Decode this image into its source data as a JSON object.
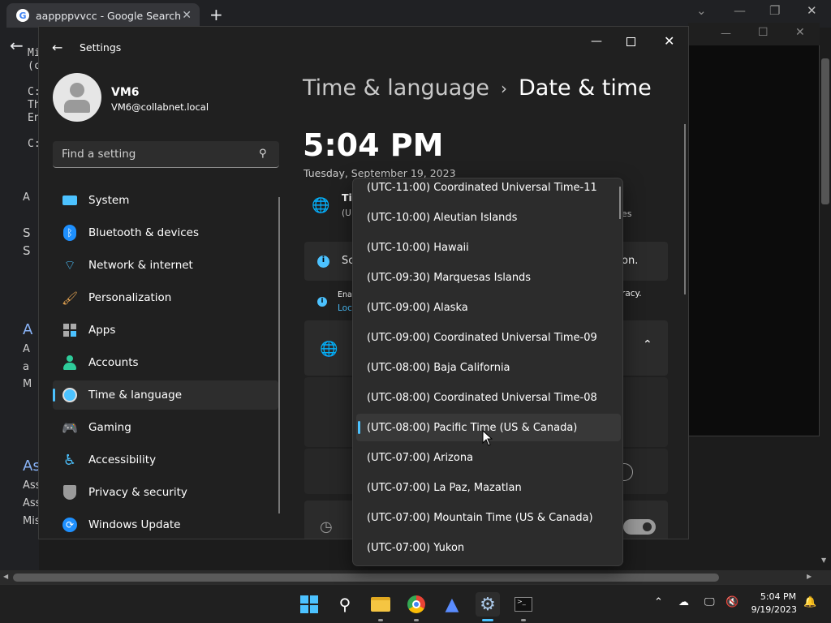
{
  "chrome": {
    "tab_title": "aappppvvcc - Google Search",
    "left_fragments": [
      "Mi",
      "(c",
      "C:",
      "Th",
      "En",
      "C:",
      "A",
      "S",
      "S",
      "A",
      "A",
      "a",
      "M",
      "As",
      "Ass",
      "Ass",
      "Mis"
    ]
  },
  "settings": {
    "window_title": "Settings",
    "user": {
      "name": "VM6",
      "email": "VM6@collabnet.local"
    },
    "search_placeholder": "Find a setting",
    "nav": [
      {
        "label": "System",
        "icon": "system-icon"
      },
      {
        "label": "Bluetooth & devices",
        "icon": "bluetooth-icon"
      },
      {
        "label": "Network & internet",
        "icon": "wifi-icon"
      },
      {
        "label": "Personalization",
        "icon": "brush-icon"
      },
      {
        "label": "Apps",
        "icon": "apps-icon"
      },
      {
        "label": "Accounts",
        "icon": "account-icon"
      },
      {
        "label": "Time & language",
        "icon": "time-language-icon",
        "active": true
      },
      {
        "label": "Gaming",
        "icon": "gamepad-icon"
      },
      {
        "label": "Accessibility",
        "icon": "accessibility-icon"
      },
      {
        "label": "Privacy & security",
        "icon": "shield-icon"
      },
      {
        "label": "Windows Update",
        "icon": "update-icon"
      }
    ],
    "breadcrumb_parent": "Time & language",
    "breadcrumb_sep": "›",
    "page_title": "Date & time",
    "current_time": "5:04 PM",
    "current_date": "Tuesday, September 19, 2023",
    "fragments": {
      "tz_title": "Ti",
      "tz_sub": "(U",
      "tz_end": "es",
      "sc": "Sc",
      "on": "on.",
      "ena": "Ena",
      "loc": "Loc",
      "racy": "racy."
    }
  },
  "timezone_dropdown": {
    "options": [
      "(UTC-11:00) Coordinated Universal Time-11",
      "(UTC-10:00) Aleutian Islands",
      "(UTC-10:00) Hawaii",
      "(UTC-09:30) Marquesas Islands",
      "(UTC-09:00) Alaska",
      "(UTC-09:00) Coordinated Universal Time-09",
      "(UTC-08:00) Baja California",
      "(UTC-08:00) Coordinated Universal Time-08",
      "(UTC-08:00) Pacific Time (US & Canada)",
      "(UTC-07:00) Arizona",
      "(UTC-07:00) La Paz, Mazatlan",
      "(UTC-07:00) Mountain Time (US & Canada)",
      "(UTC-07:00) Yukon"
    ],
    "selected": "(UTC-08:00) Pacific Time (US & Canada)"
  },
  "taskbar": {
    "apps": [
      "start-icon",
      "search-icon",
      "file-explorer-icon",
      "chrome-icon",
      "app-icon",
      "settings-icon",
      "terminal-icon"
    ],
    "time": "5:04 PM",
    "date": "9/19/2023"
  },
  "colors": {
    "accent": "#4cc2ff",
    "window_bg": "#202020",
    "dropdown_bg": "#2c2c2c"
  }
}
